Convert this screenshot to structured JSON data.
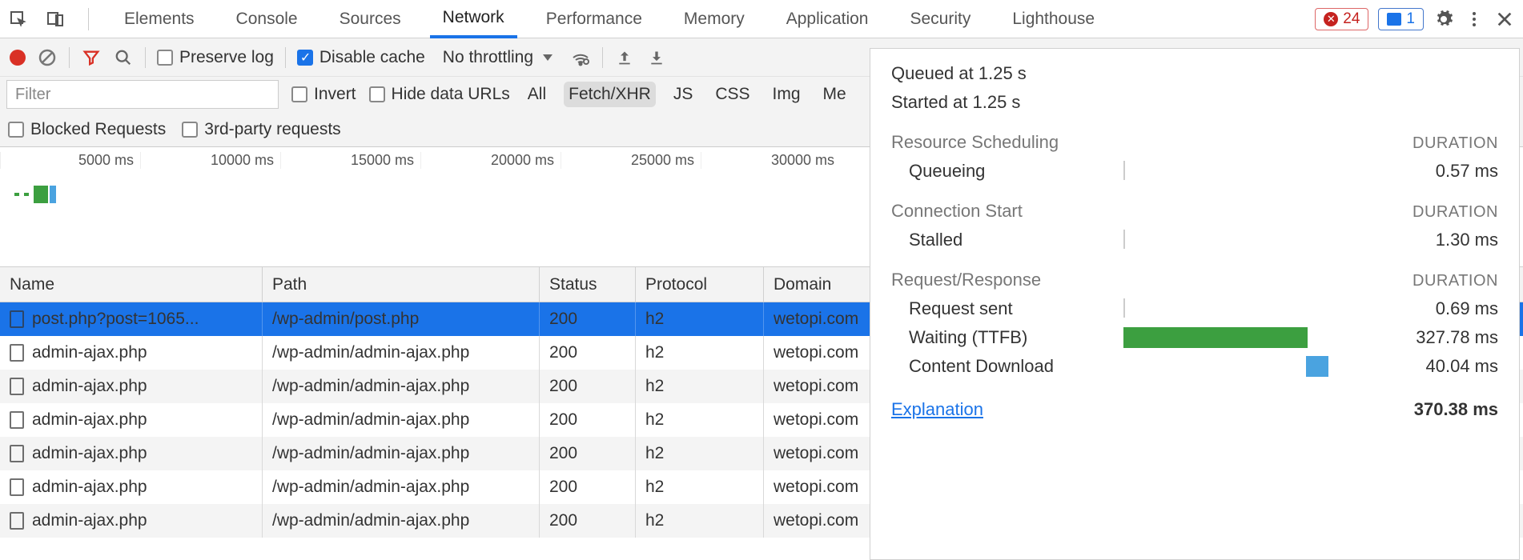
{
  "tabs": {
    "elements": "Elements",
    "console": "Console",
    "sources": "Sources",
    "network": "Network",
    "performance": "Performance",
    "memory": "Memory",
    "application": "Application",
    "security": "Security",
    "lighthouse": "Lighthouse"
  },
  "error_badge": "24",
  "message_badge": "1",
  "toolbar": {
    "preserve_log": "Preserve log",
    "disable_cache": "Disable cache",
    "throttling": "No throttling"
  },
  "filter": {
    "placeholder": "Filter",
    "invert": "Invert",
    "hide_data_urls": "Hide data URLs",
    "types": {
      "all": "All",
      "fetchxhr": "Fetch/XHR",
      "js": "JS",
      "css": "CSS",
      "img": "Img",
      "me": "Me"
    },
    "blocked": "Blocked Requests",
    "thirdparty": "3rd-party requests"
  },
  "timeline_ticks": [
    "5000 ms",
    "10000 ms",
    "15000 ms",
    "20000 ms",
    "25000 ms",
    "30000 ms"
  ],
  "columns": {
    "name": "Name",
    "path": "Path",
    "status": "Status",
    "protocol": "Protocol",
    "domain": "Domain"
  },
  "rows": [
    {
      "name": "post.php?post=1065...",
      "path": "/wp-admin/post.php",
      "status": "200",
      "protocol": "h2",
      "domain": "wetopi.com",
      "selected": true
    },
    {
      "name": "admin-ajax.php",
      "path": "/wp-admin/admin-ajax.php",
      "status": "200",
      "protocol": "h2",
      "domain": "wetopi.com"
    },
    {
      "name": "admin-ajax.php",
      "path": "/wp-admin/admin-ajax.php",
      "status": "200",
      "protocol": "h2",
      "domain": "wetopi.com"
    },
    {
      "name": "admin-ajax.php",
      "path": "/wp-admin/admin-ajax.php",
      "status": "200",
      "protocol": "h2",
      "domain": "wetopi.com"
    },
    {
      "name": "admin-ajax.php",
      "path": "/wp-admin/admin-ajax.php",
      "status": "200",
      "protocol": "h2",
      "domain": "wetopi.com"
    },
    {
      "name": "admin-ajax.php",
      "path": "/wp-admin/admin-ajax.php",
      "status": "200",
      "protocol": "h2",
      "domain": "wetopi.com"
    },
    {
      "name": "admin-ajax.php",
      "path": "/wp-admin/admin-ajax.php",
      "status": "200",
      "protocol": "h2",
      "domain": "wetopi.com"
    }
  ],
  "timing": {
    "queued": "Queued at 1.25 s",
    "started": "Started at 1.25 s",
    "duration_header": "DURATION",
    "s1_title": "Resource Scheduling",
    "queueing_label": "Queueing",
    "queueing_val": "0.57 ms",
    "s2_title": "Connection Start",
    "stalled_label": "Stalled",
    "stalled_val": "1.30 ms",
    "s3_title": "Request/Response",
    "reqsent_label": "Request sent",
    "reqsent_val": "0.69 ms",
    "waiting_label": "Waiting (TTFB)",
    "waiting_val": "327.78 ms",
    "content_label": "Content Download",
    "content_val": "40.04 ms",
    "explanation": "Explanation",
    "total": "370.38 ms"
  }
}
